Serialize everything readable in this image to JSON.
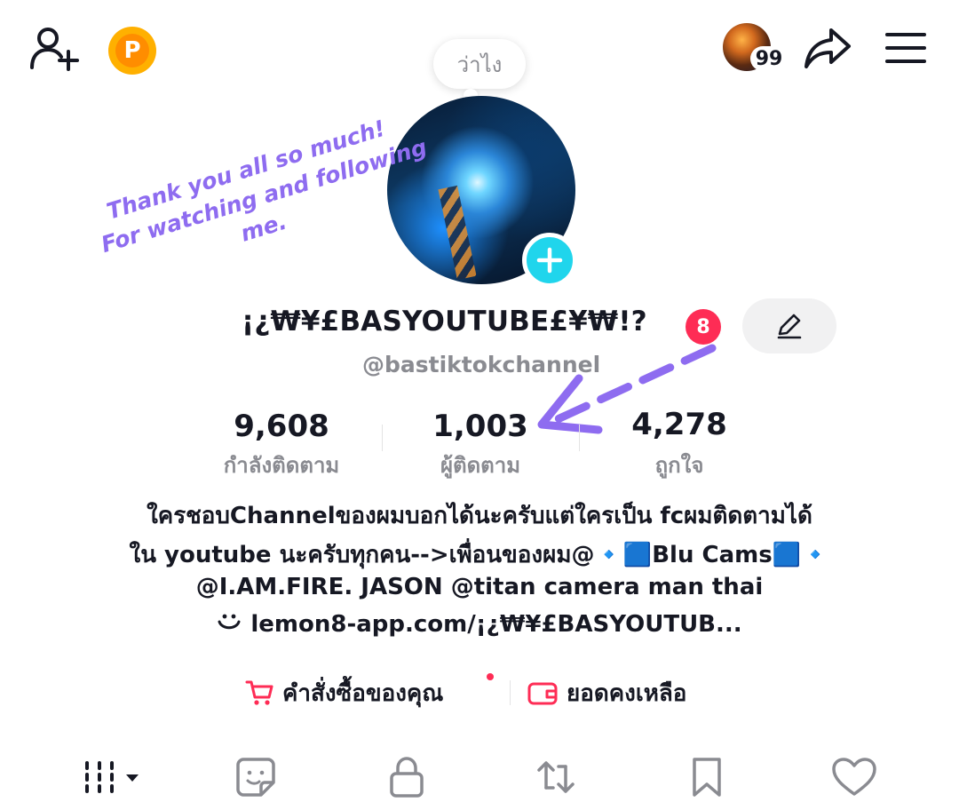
{
  "header": {
    "story_badge": "99",
    "coin_letter": "P"
  },
  "bubble": {
    "text": "ว่าไง"
  },
  "annotation": {
    "lines": [
      "Thank you all so much!",
      "For watching and following",
      "me."
    ],
    "color": "#8e6cf0"
  },
  "profile": {
    "display_name": "¡¿₩¥£BASYOUTUBE£¥₩!?",
    "badge_count": "8",
    "username": "@bastiktokchannel"
  },
  "stats": {
    "following": {
      "value": "9,608",
      "label": "กำลังติดตาม"
    },
    "followers": {
      "value": "1,003",
      "label": "ผู้ติดตาม"
    },
    "likes": {
      "value": "4,278",
      "label": "ถูกใจ"
    }
  },
  "bio": {
    "line1": "ใครชอบChannelของผมบอกได้นะครับแต่ใครเป็น fcผมติดตามได้",
    "line2": "ใน youtube นะครับทุกคน-->เพื่อนของผม@🔹🟦Blu Cams🟦🔹",
    "line3": "@I.AM.FIRE. JASON @titan camera man thai",
    "link": "lemon8-app.com/¡¿₩¥£BASYOUTUB..."
  },
  "shop": {
    "orders_label": "คำสั่งซื้อของคุณ",
    "balance_label": "ยอดคงเหลือ"
  },
  "colors": {
    "accent_red": "#fe2c55",
    "accent_cyan": "#20d5ec",
    "coin": "#ffb000"
  },
  "tabs": [
    "videos-grid",
    "stickers",
    "private",
    "reposts",
    "favorites",
    "liked"
  ]
}
